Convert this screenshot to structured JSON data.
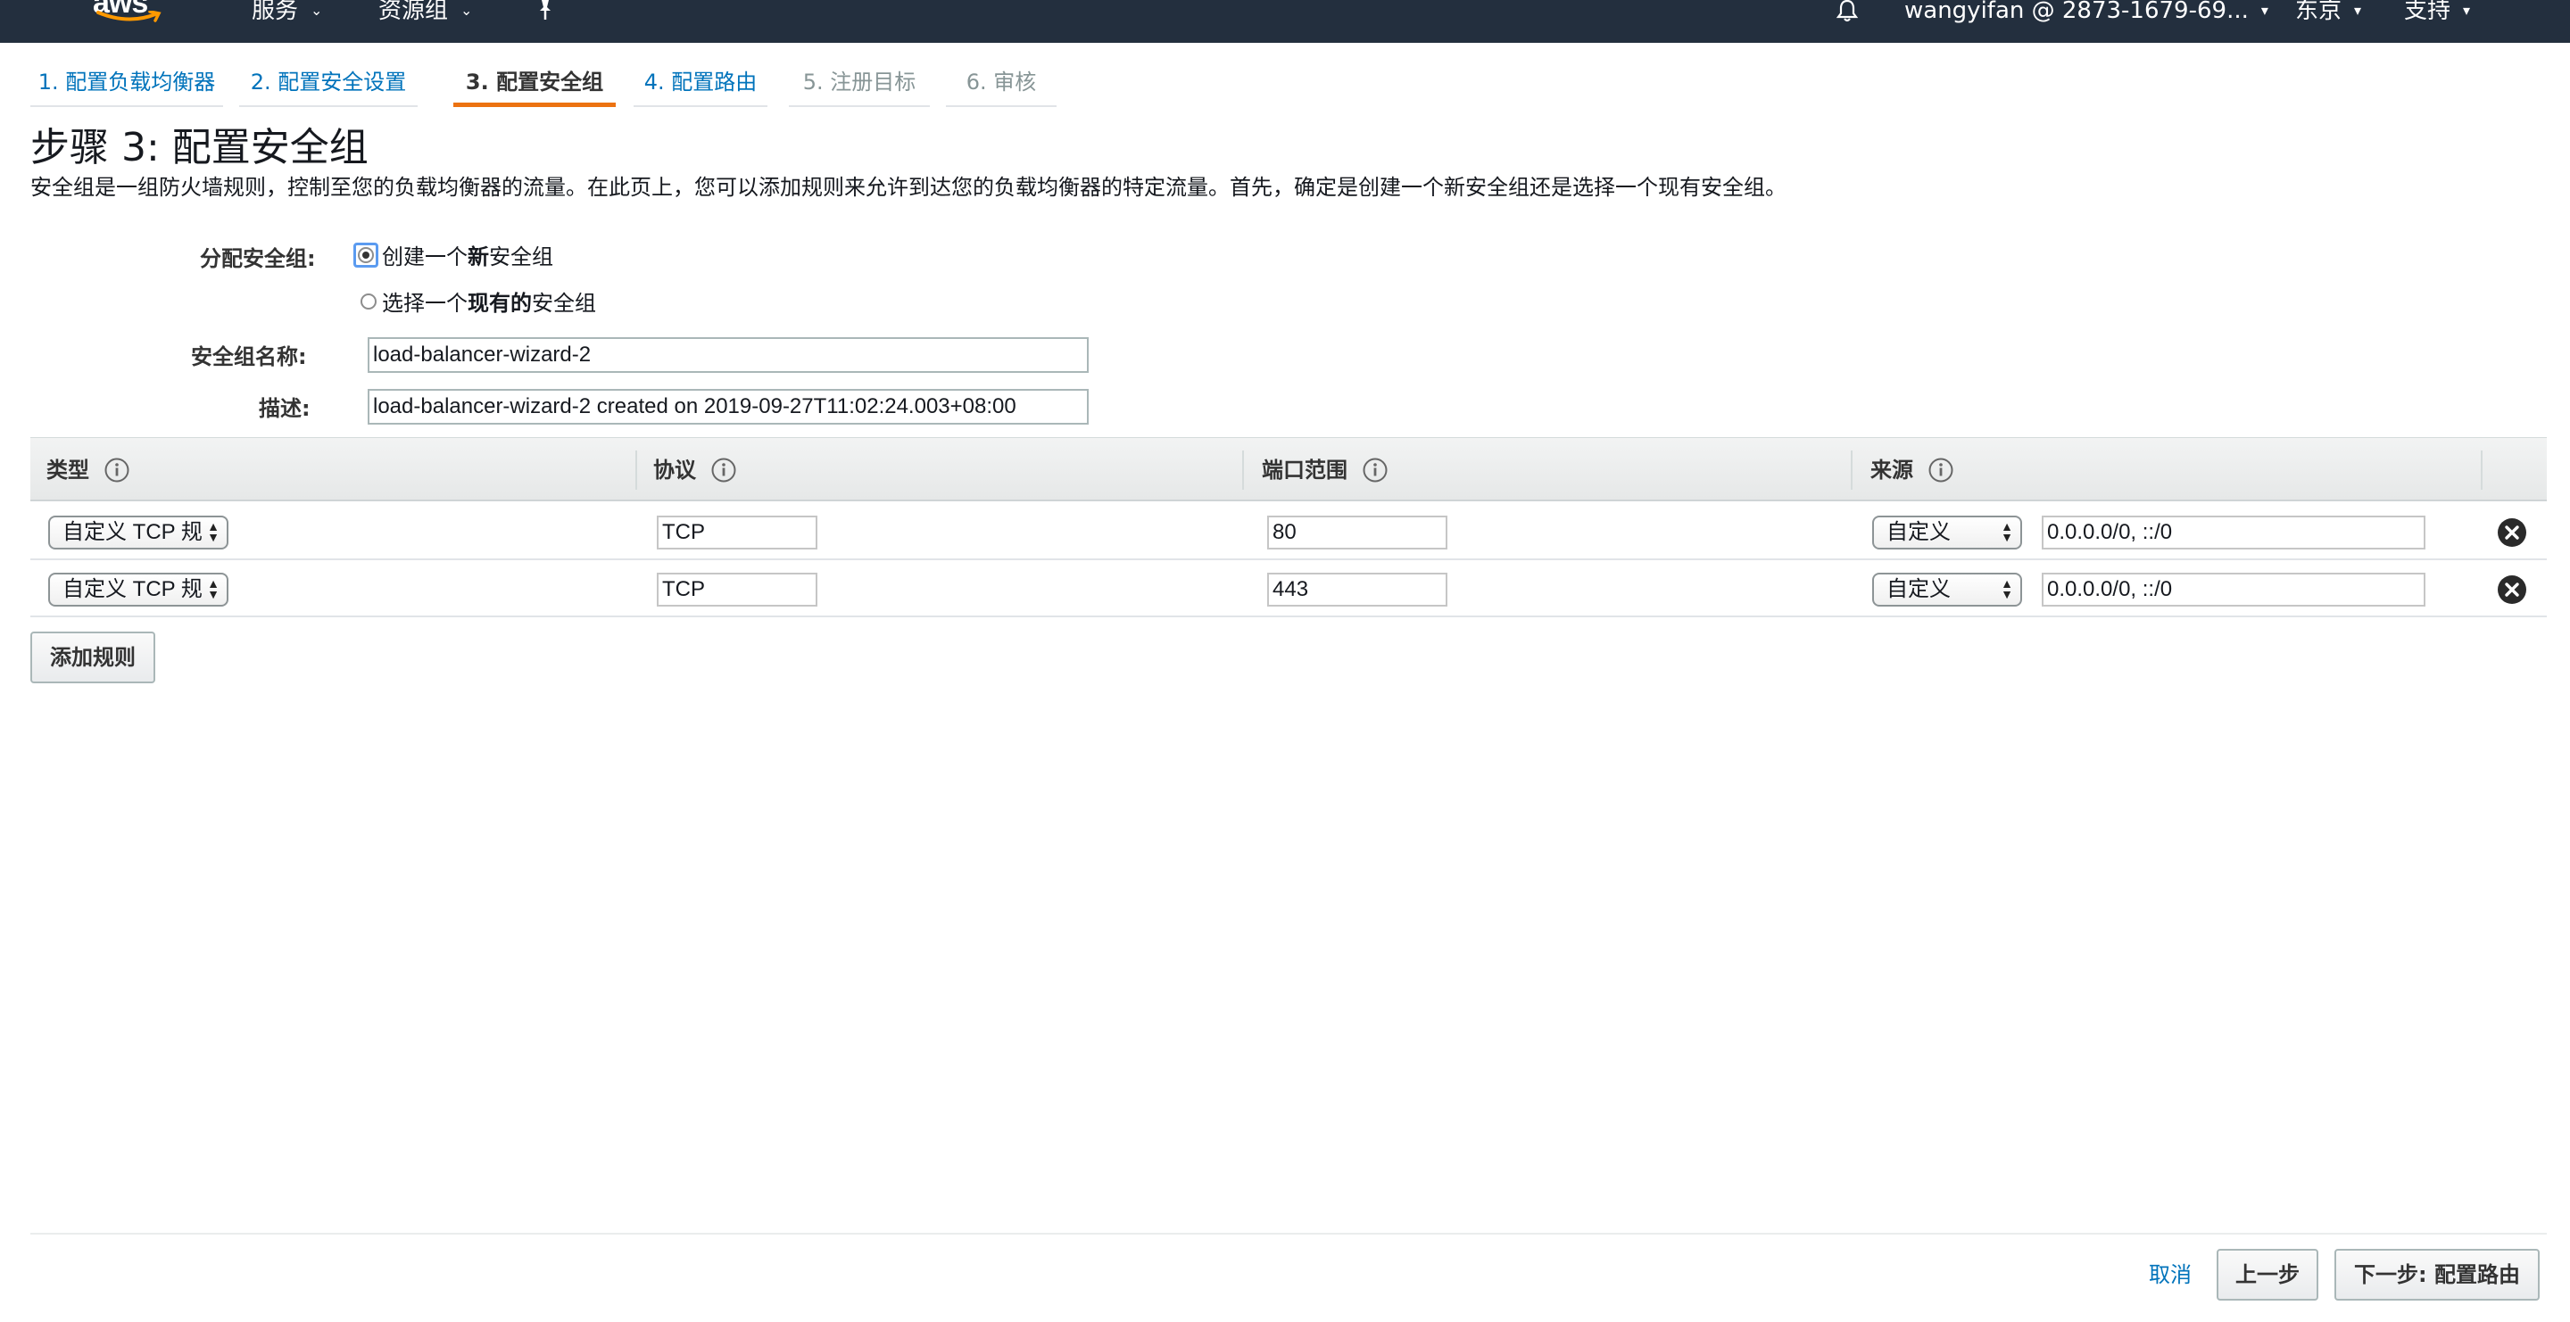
{
  "topbar": {
    "logo_text": "aws",
    "services": "服务",
    "resource_groups": "资源组",
    "account": "wangyifan @ 2873-1679-69...",
    "region": "东京",
    "support": "支持"
  },
  "steps": [
    {
      "label": "1. 配置负载均衡器",
      "state": "link"
    },
    {
      "label": "2. 配置安全设置",
      "state": "link"
    },
    {
      "label": "3. 配置安全组",
      "state": "active"
    },
    {
      "label": "4. 配置路由",
      "state": "link"
    },
    {
      "label": "5. 注册目标",
      "state": "disabled"
    },
    {
      "label": "6. 审核",
      "state": "disabled"
    }
  ],
  "page": {
    "title": "步骤 3: 配置安全组",
    "description": "安全组是一组防火墙规则，控制至您的负载均衡器的流量。在此页上，您可以添加规则来允许到达您的负载均衡器的特定流量。首先，确定是创建一个新安全组还是选择一个现有安全组。"
  },
  "form": {
    "assign_label": "分配安全组:",
    "option_new_pre": "创建一个",
    "option_new_bold": "新",
    "option_new_post": "安全组",
    "option_existing_pre": "选择一个",
    "option_existing_bold": "现有的",
    "option_existing_post": "安全组",
    "name_label": "安全组名称:",
    "name_value": "load-balancer-wizard-2",
    "desc_label": "描述:",
    "desc_value": "load-balancer-wizard-2 created on 2019-09-27T11:02:24.003+08:00"
  },
  "table": {
    "headers": [
      "类型",
      "协议",
      "端口范围",
      "来源"
    ],
    "rows": [
      {
        "type": "自定义 TCP 规",
        "protocol": "TCP",
        "port": "80",
        "source_type": "自定义",
        "source": "0.0.0.0/0, ::/0"
      },
      {
        "type": "自定义 TCP 规",
        "protocol": "TCP",
        "port": "443",
        "source_type": "自定义",
        "source": "0.0.0.0/0, ::/0"
      }
    ],
    "add_rule": "添加规则"
  },
  "footer": {
    "cancel": "取消",
    "previous": "上一步",
    "next": "下一步: 配置路由"
  },
  "colors": {
    "topbar": "#232f3e",
    "link": "#0073bb",
    "active_tab": "#ec7211"
  }
}
